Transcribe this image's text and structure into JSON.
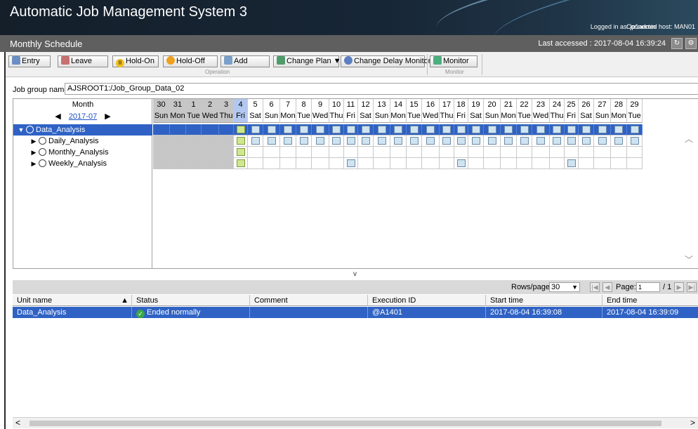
{
  "header": {
    "app_title": "Automatic Job Management System 3",
    "logged_in": "Logged in as: jp1admin",
    "connected_host": "Connected host: MAN01"
  },
  "window": {
    "title": "Monthly Schedule",
    "last_accessed": "Last accessed : 2017-08-04 16:39:24"
  },
  "toolbar": {
    "entry": "Entry",
    "leave": "Leave",
    "hold_on": "Hold-On",
    "hold_off": "Hold-Off",
    "add": "Add",
    "change_plan": "Change Plan ▼",
    "change_delay_monitor": "Change Delay Monitor",
    "monitor": "Monitor",
    "group_operation": "Operation",
    "group_monitor": "Monitor"
  },
  "job_group": {
    "label": "Job group name:",
    "value": "AJSROOT1:/Job_Group_Data_02"
  },
  "calendar": {
    "month_label": "Month",
    "month_value": "2017-07",
    "prev_arrow": "◀",
    "next_arrow": "▶",
    "days": [
      {
        "n": "30",
        "w": "Sun",
        "state": "gray"
      },
      {
        "n": "31",
        "w": "Mon",
        "state": "gray"
      },
      {
        "n": "1",
        "w": "Tue",
        "state": "gray"
      },
      {
        "n": "2",
        "w": "Wed",
        "state": "gray"
      },
      {
        "n": "3",
        "w": "Thu",
        "state": "gray"
      },
      {
        "n": "4",
        "w": "Fri",
        "state": "today"
      },
      {
        "n": "5",
        "w": "Sat",
        "state": ""
      },
      {
        "n": "6",
        "w": "Sun",
        "state": ""
      },
      {
        "n": "7",
        "w": "Mon",
        "state": ""
      },
      {
        "n": "8",
        "w": "Tue",
        "state": ""
      },
      {
        "n": "9",
        "w": "Wed",
        "state": ""
      },
      {
        "n": "10",
        "w": "Thu",
        "state": ""
      },
      {
        "n": "11",
        "w": "Fri",
        "state": ""
      },
      {
        "n": "12",
        "w": "Sat",
        "state": ""
      },
      {
        "n": "13",
        "w": "Sun",
        "state": ""
      },
      {
        "n": "14",
        "w": "Mon",
        "state": ""
      },
      {
        "n": "15",
        "w": "Tue",
        "state": ""
      },
      {
        "n": "16",
        "w": "Wed",
        "state": ""
      },
      {
        "n": "17",
        "w": "Thu",
        "state": ""
      },
      {
        "n": "18",
        "w": "Fri",
        "state": ""
      },
      {
        "n": "19",
        "w": "Sat",
        "state": ""
      },
      {
        "n": "20",
        "w": "Sun",
        "state": ""
      },
      {
        "n": "21",
        "w": "Mon",
        "state": ""
      },
      {
        "n": "22",
        "w": "Tue",
        "state": ""
      },
      {
        "n": "23",
        "w": "Wed",
        "state": ""
      },
      {
        "n": "24",
        "w": "Thu",
        "state": ""
      },
      {
        "n": "25",
        "w": "Fri",
        "state": ""
      },
      {
        "n": "26",
        "w": "Sat",
        "state": ""
      },
      {
        "n": "27",
        "w": "Sun",
        "state": ""
      },
      {
        "n": "28",
        "w": "Mon",
        "state": ""
      },
      {
        "n": "29",
        "w": "Tue",
        "state": ""
      }
    ],
    "units": [
      {
        "name": "Data_Analysis",
        "expander": "▼",
        "selected": true,
        "scheduled_days": [
          "4",
          "5",
          "6",
          "7",
          "8",
          "9",
          "10",
          "11",
          "12",
          "13",
          "14",
          "15",
          "16",
          "17",
          "18",
          "19",
          "20",
          "21",
          "22",
          "23",
          "24",
          "25",
          "26",
          "27",
          "28",
          "29"
        ]
      },
      {
        "name": "Daily_Analysis",
        "expander": "▶",
        "selected": false,
        "scheduled_days": [
          "4",
          "5",
          "6",
          "7",
          "8",
          "9",
          "10",
          "11",
          "12",
          "13",
          "14",
          "15",
          "16",
          "17",
          "18",
          "19",
          "20",
          "21",
          "22",
          "23",
          "24",
          "25",
          "26",
          "27",
          "28",
          "29"
        ]
      },
      {
        "name": "Monthly_Analysis",
        "expander": "▶",
        "selected": false,
        "scheduled_days": [
          "4"
        ]
      },
      {
        "name": "Weekly_Analysis",
        "expander": "▶",
        "selected": false,
        "scheduled_days": [
          "4",
          "11",
          "18",
          "25"
        ]
      }
    ]
  },
  "splitter_glyph": "v",
  "pager": {
    "rows_label": "Rows/page:",
    "rows_value": "30",
    "page_label": "Page:",
    "page_value": "1",
    "page_total": "/ 1"
  },
  "results": {
    "columns": [
      "Unit name",
      "Status",
      "Comment",
      "Execution ID",
      "Start time",
      "End time"
    ],
    "sort_indicator": "▲",
    "rows": [
      {
        "unit_name": "Data_Analysis",
        "status": "Ended normally",
        "comment": "",
        "execution_id": "@A1401",
        "start_time": "2017-08-04 16:39:08",
        "end_time": "2017-08-04 16:39:09"
      }
    ]
  },
  "colors": {
    "selection": "#2f62c4",
    "scheduled_fill": "#cfe3f0",
    "today_fill": "#cfe88e",
    "ended_normally": "#3aa845"
  }
}
